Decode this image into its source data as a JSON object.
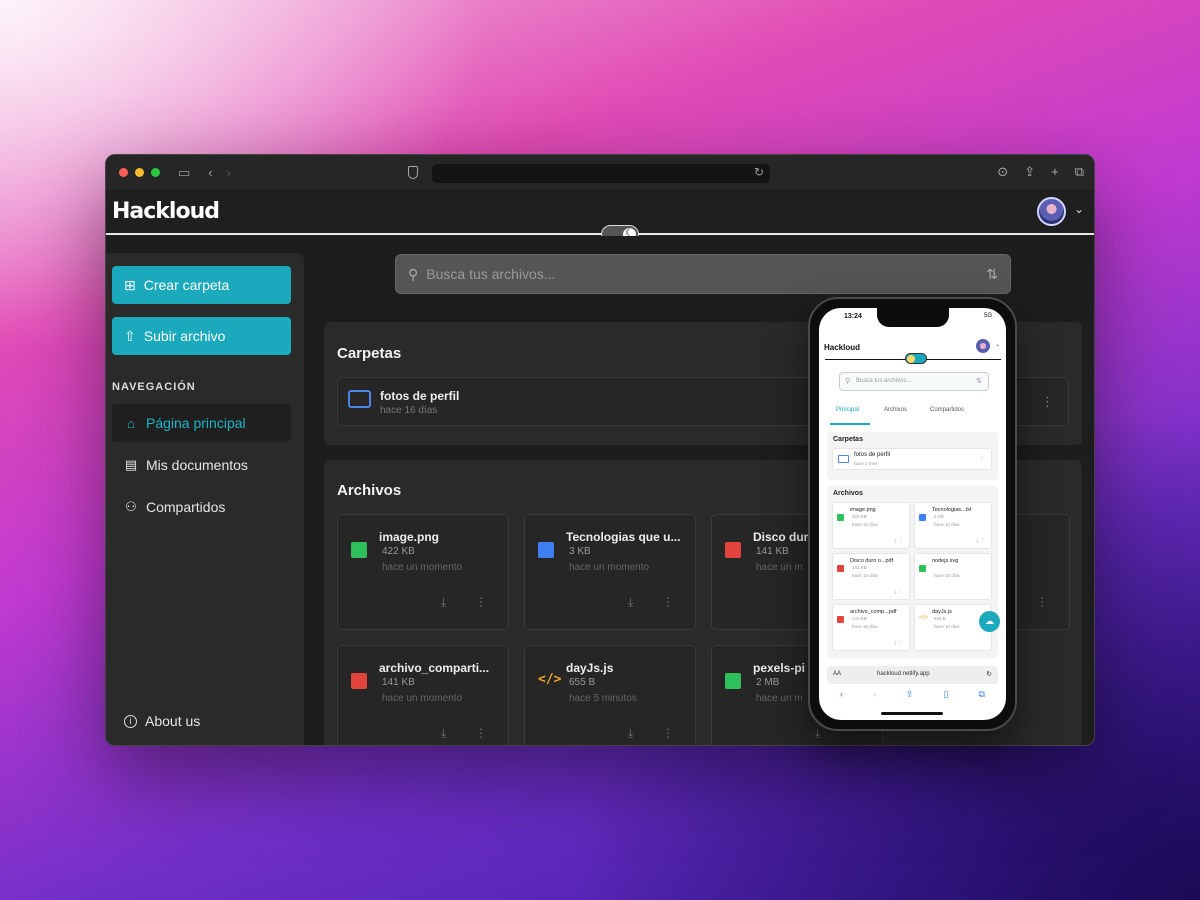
{
  "app": {
    "logo": "Hackloud",
    "theme_toggle": "dark"
  },
  "browser": {
    "url": "",
    "icons": [
      "sidebar-icon",
      "back-icon",
      "forward-icon",
      "shield-icon",
      "reload-icon",
      "download-icon",
      "share-icon",
      "plus-icon",
      "tabs-icon"
    ]
  },
  "sidebar": {
    "create_folder": "Crear carpeta",
    "upload_file": "Subir archivo",
    "nav_title": "NAVEGACIÓN",
    "items": [
      {
        "label": "Página principal",
        "icon": "home-icon",
        "active": true
      },
      {
        "label": "Mis documentos",
        "icon": "document-icon",
        "active": false
      },
      {
        "label": "Compartidos",
        "icon": "users-icon",
        "active": false
      }
    ],
    "about": "About us"
  },
  "search": {
    "placeholder": "Busca tus archivos..."
  },
  "folders_section": {
    "title": "Carpetas",
    "folders": [
      {
        "name": "fotos de perfil",
        "time": "hace 16 días"
      }
    ]
  },
  "files_section": {
    "title": "Archivos",
    "files": [
      {
        "name": "image.png",
        "size": "422 KB",
        "time": "hace un momento",
        "type": "img"
      },
      {
        "name": "Tecnologias que u...",
        "size": "3 KB",
        "time": "hace un momento",
        "type": "doc"
      },
      {
        "name": "Disco dur",
        "size": "141 KB",
        "time": "hace un m",
        "type": "pdf"
      },
      {
        "name": "archivo_comparti...",
        "size": "141 KB",
        "time": "hace un momento",
        "type": "pdf"
      },
      {
        "name": "dayJs.js",
        "size": "655 B",
        "time": "hace 5 minutos",
        "type": "js"
      },
      {
        "name": "pexels-pi",
        "size": "2 MB",
        "time": "hace un m",
        "type": "img"
      }
    ]
  },
  "phone": {
    "time": "13:24",
    "signal": "5G",
    "logo": "Hackloud",
    "search_placeholder": "Busca tus archivos...",
    "tabs": [
      "Principal",
      "Archivos",
      "Compartidos"
    ],
    "folders_title": "Carpetas",
    "folder": {
      "name": "fotos de perfil",
      "time": "hace 1 mes"
    },
    "files_title": "Archivos",
    "files": [
      {
        "name": "image.png",
        "size": "422 KB",
        "time": "hace 10 días",
        "type": "img"
      },
      {
        "name": "Tecnologias...txt",
        "size": "3 KB",
        "time": "hace 10 días",
        "type": "doc"
      },
      {
        "name": "Disco duro o...pdf",
        "size": "141 KB",
        "time": "hace 10 días",
        "type": "pdf"
      },
      {
        "name": "nodejs.svg",
        "size": "",
        "time": "hace 10 días",
        "type": "img"
      },
      {
        "name": "archivo_comp...pdf",
        "size": "141 KB",
        "time": "hace 10 días",
        "type": "pdf"
      },
      {
        "name": "dayJs.js",
        "size": "655 B",
        "time": "hace 10 días",
        "type": "js"
      }
    ],
    "url": "hackloud.netlify.app",
    "aa": "AA"
  },
  "colors": {
    "accent": "#1aa9bd",
    "background": "#1f1f1f",
    "panel": "#2a2a2a"
  }
}
